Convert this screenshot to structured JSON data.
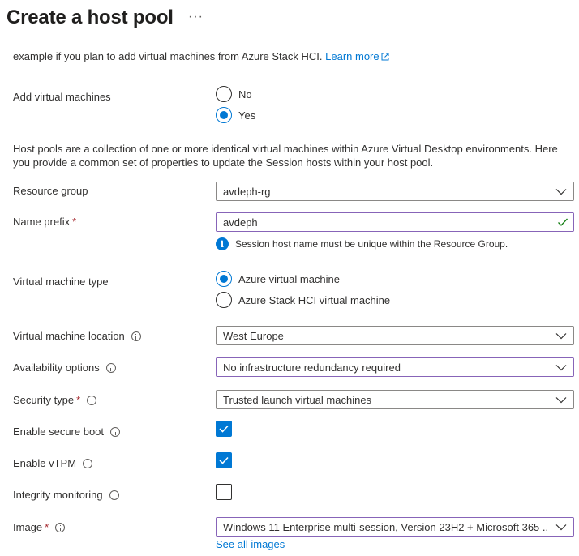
{
  "header": {
    "title": "Create a host pool",
    "more": "···"
  },
  "intro": {
    "text": "example if you plan to add virtual machines from Azure Stack HCI. ",
    "link": "Learn more"
  },
  "add_vms": {
    "label": "Add virtual machines",
    "options": [
      "No",
      "Yes"
    ],
    "selected": "Yes"
  },
  "description": "Host pools are a collection of one or more identical virtual machines within Azure Virtual Desktop environments. Here you provide a common set of properties to update the Session hosts within your host pool.",
  "resource_group": {
    "label": "Resource group",
    "value": "avdeph-rg"
  },
  "name_prefix": {
    "label": "Name prefix",
    "required": "*",
    "value": "avdeph",
    "hint": "Session host name must be unique within the Resource Group."
  },
  "vm_type": {
    "label": "Virtual machine type",
    "options": [
      "Azure virtual machine",
      "Azure Stack HCI virtual machine"
    ],
    "selected": "Azure virtual machine"
  },
  "vm_location": {
    "label": "Virtual machine location",
    "value": "West Europe"
  },
  "availability": {
    "label": "Availability options",
    "value": "No infrastructure redundancy required"
  },
  "security_type": {
    "label": "Security type",
    "required": "*",
    "value": "Trusted launch virtual machines"
  },
  "secure_boot": {
    "label": "Enable secure boot",
    "checked": true
  },
  "vtpm": {
    "label": "Enable vTPM",
    "checked": true
  },
  "integrity": {
    "label": "Integrity monitoring",
    "checked": false
  },
  "image": {
    "label": "Image",
    "required": "*",
    "value": "Windows 11 Enterprise multi-session, Version 23H2 + Microsoft 365 ...",
    "see_all": "See all images"
  },
  "colors": {
    "accent": "#0078d4",
    "focus_border": "#8764b8",
    "required": "#a4262c",
    "valid": "#107c10"
  }
}
